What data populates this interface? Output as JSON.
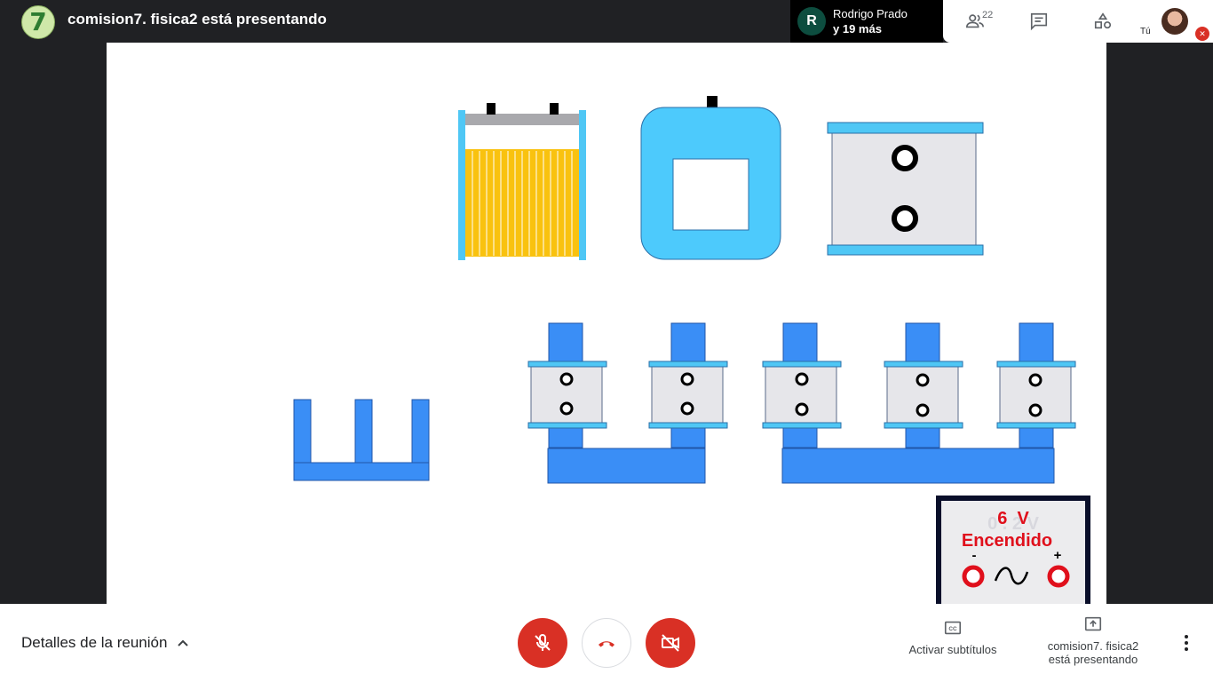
{
  "header": {
    "title": "comision7. fisica2 está presentando",
    "presenter_avatar_text": "7",
    "participants": {
      "avatar_letter": "R",
      "name": "Rodrigo Prado",
      "more": "y 19 más"
    },
    "people_count": "22",
    "self_label": "Tú",
    "icons": [
      "people-icon",
      "chat-icon",
      "activities-icon",
      "mic-off-icon"
    ]
  },
  "slide": {
    "power_supply": {
      "voltage": "6  V",
      "status": "Encendido",
      "minus": "-",
      "plus": "+",
      "faint_text": "0 . 2 V",
      "ac_symbol": "∿"
    },
    "colors": {
      "core_blue": "#3a8ef6",
      "light_blue": "#4fc7f5",
      "coil_yellow": "#f9c20f",
      "gray": "#e6e6ea",
      "terminal_red": "#e0101c"
    }
  },
  "footer": {
    "details_label": "Detalles de la reunión",
    "captions_label": "Activar subtítulos",
    "presenting_label_line1": "comision7. fisica2",
    "presenting_label_line2": "está presentando",
    "colors": {
      "danger": "#d93025"
    }
  }
}
